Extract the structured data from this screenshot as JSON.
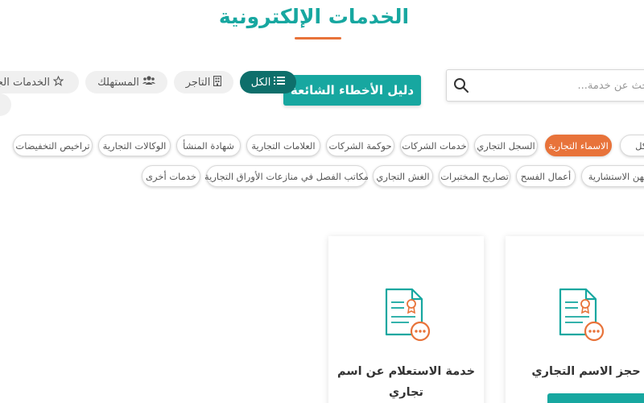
{
  "header": {
    "title": "الخدمات الإلكترونية"
  },
  "search": {
    "placeholder": "ابحث عن خدمة..."
  },
  "faq_button": {
    "label": "دليل الأخطاء الشائعة"
  },
  "filter_tabs": [
    {
      "label": "الكل",
      "icon": "list-icon",
      "active": true
    },
    {
      "label": "التاجر",
      "icon": "building-icon",
      "active": false
    },
    {
      "label": "المستهلك",
      "icon": "users-icon",
      "active": false
    },
    {
      "label": "الخدمات الجد",
      "icon": "star-icon",
      "active": false
    }
  ],
  "category_chips_row1": [
    {
      "label": "الكل",
      "active": false
    },
    {
      "label": "الاسماء التجارية",
      "active": true
    },
    {
      "label": "السجل التجاري",
      "active": false
    },
    {
      "label": "خدمات الشركات",
      "active": false
    },
    {
      "label": "حوكمة الشركات",
      "active": false
    },
    {
      "label": "العلامات التجارية",
      "active": false
    },
    {
      "label": "شهادة المنشأ",
      "active": false
    },
    {
      "label": "الوكالات التجارية",
      "active": false
    },
    {
      "label": "تراخيص التخفيضات",
      "active": false
    }
  ],
  "category_chips_row2": [
    {
      "label": "المهن الاستشارية",
      "active": false
    },
    {
      "label": "أعمال الفسح",
      "active": false
    },
    {
      "label": "تصاريح المختبرات",
      "active": false
    },
    {
      "label": "الغش التجاري",
      "active": false
    },
    {
      "label": "مكاتب الفصل في منازعات الأوراق التجارية",
      "active": false
    },
    {
      "label": "خدمات أخرى",
      "active": false
    }
  ],
  "service_cards": [
    {
      "title": "حجز الاسم التجاري",
      "icon": "certificate-document-icon"
    },
    {
      "title": "خدمة الاستعلام عن اسم تجاري",
      "icon": "certificate-document-icon"
    }
  ],
  "colors": {
    "primary": "#17a7a0",
    "primary_dark": "#0e6f6b",
    "accent": "#e8733a"
  }
}
